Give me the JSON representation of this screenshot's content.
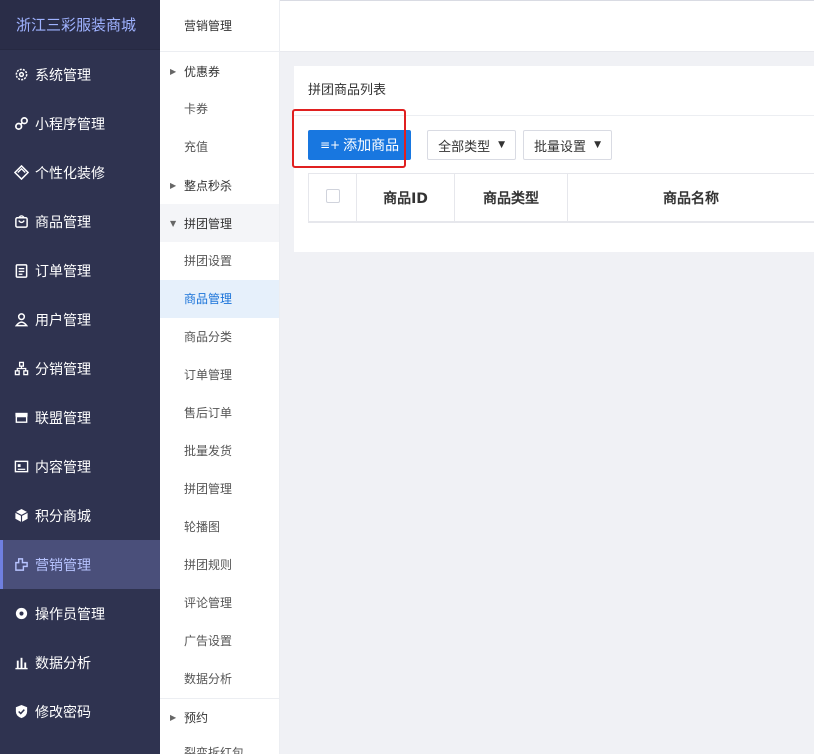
{
  "brand": "浙江三彩服装商城",
  "sidebar": {
    "items": [
      {
        "label": "系统管理",
        "icon": "gear-icon"
      },
      {
        "label": "小程序管理",
        "icon": "miniprogram-icon"
      },
      {
        "label": "个性化装修",
        "icon": "decoration-icon"
      },
      {
        "label": "商品管理",
        "icon": "bag-icon"
      },
      {
        "label": "订单管理",
        "icon": "clipboard-icon"
      },
      {
        "label": "用户管理",
        "icon": "user-icon"
      },
      {
        "label": "分销管理",
        "icon": "org-chart-icon"
      },
      {
        "label": "联盟管理",
        "icon": "store-icon"
      },
      {
        "label": "内容管理",
        "icon": "content-icon"
      },
      {
        "label": "积分商城",
        "icon": "cube-icon"
      },
      {
        "label": "营销管理",
        "icon": "marketing-icon",
        "active": true
      },
      {
        "label": "操作员管理",
        "icon": "gear-solid-icon"
      },
      {
        "label": "数据分析",
        "icon": "bar-chart-icon"
      },
      {
        "label": "修改密码",
        "icon": "shield-check-icon"
      }
    ]
  },
  "submenu": {
    "title": "营销管理",
    "coupon": "优惠券",
    "card_coupon": "卡券",
    "recharge": "充值",
    "flash_sale": "整点秒杀",
    "group_buy": "拼团管理",
    "group_items": [
      "拼团设置",
      "商品管理",
      "商品分类",
      "订单管理",
      "售后订单",
      "批量发货",
      "拼团管理",
      "轮播图",
      "拼团规则",
      "评论管理",
      "广告设置",
      "数据分析"
    ],
    "reservation": "预约",
    "cut_off": "裂变拆红包"
  },
  "main": {
    "card_title": "拼团商品列表",
    "add_button": "添加商品",
    "type_select": "全部类型",
    "batch_select": "批量设置",
    "columns": [
      "商品ID",
      "商品类型",
      "商品名称"
    ]
  }
}
